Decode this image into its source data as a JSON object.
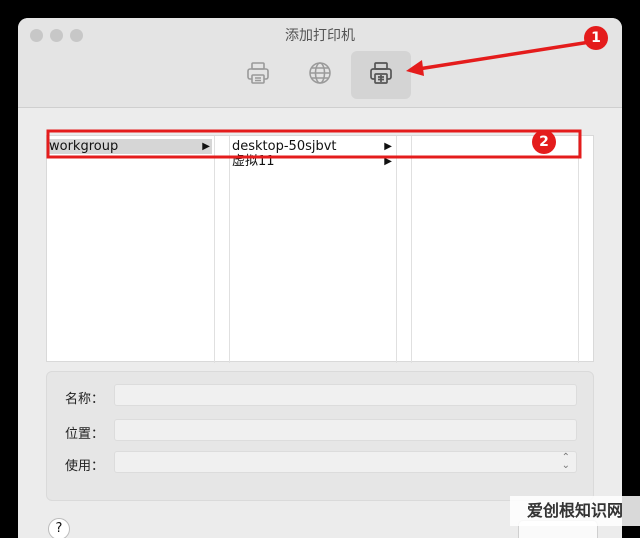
{
  "window": {
    "title": "添加打印机"
  },
  "toolbar": {
    "buttons": [
      {
        "icon": "printer-icon",
        "active": false
      },
      {
        "icon": "globe-icon",
        "active": false
      },
      {
        "icon": "windows-printer-icon",
        "active": true
      }
    ]
  },
  "browser": {
    "column1": [
      {
        "label": "workgroup",
        "selected": true,
        "has_children": true
      }
    ],
    "column2": [
      {
        "label": "desktop-50sjbvt",
        "selected": false,
        "has_children": true
      },
      {
        "label": "虚拟11",
        "selected": false,
        "has_children": true
      }
    ],
    "column3": []
  },
  "form": {
    "name_label": "名称：",
    "name_value": "",
    "location_label": "位置：",
    "location_value": "",
    "use_label": "使用：",
    "use_value": ""
  },
  "help": {
    "label": "?"
  },
  "annotations": {
    "badge1": "1",
    "badge2": "2",
    "color": "#e41c1c"
  },
  "watermark": {
    "text": "爱创根知识网"
  }
}
